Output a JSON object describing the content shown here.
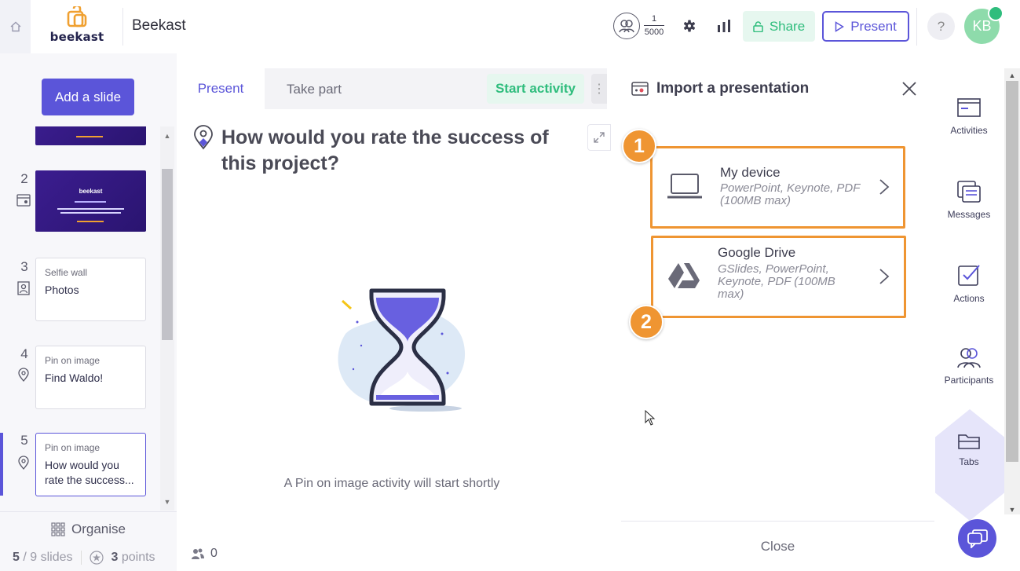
{
  "header": {
    "app_title": "Beekast",
    "logo_text": "beekast",
    "participants_current": "1",
    "participants_max": "5000",
    "share_label": "Share",
    "present_label": "Present",
    "help_label": "?",
    "avatar_initials": "KB"
  },
  "sidebar": {
    "add_slide_label": "Add a slide",
    "slides": [
      {
        "number": "2",
        "thumb_text": "beekast"
      },
      {
        "number": "3",
        "type": "Selfie wall",
        "title": "Photos"
      },
      {
        "number": "4",
        "type": "Pin on image",
        "title": "Find Waldo!"
      },
      {
        "number": "5",
        "type": "Pin on image",
        "title": "How would you rate the success..."
      }
    ],
    "organise_label": "Organise",
    "slide_current": "5",
    "slide_total": "/ 9 slides",
    "points_value": "3",
    "points_label": "points"
  },
  "center": {
    "tab_present": "Present",
    "tab_take_part": "Take part",
    "start_activity": "Start activity",
    "more": "⋮",
    "question": "How would you rate the success of this project?",
    "waiting_text": "A Pin on image activity will start shortly",
    "participants_count": "0"
  },
  "import_panel": {
    "title": "Import a presentation",
    "options": [
      {
        "step": "1",
        "title": "My device",
        "subtitle_line1": "PowerPoint, Keynote, PDF",
        "subtitle_line2": "(100MB max)"
      },
      {
        "step": "2",
        "title": "Google Drive",
        "subtitle_line1": "GSlides, PowerPoint,",
        "subtitle_line2": "Keynote, PDF (100MB",
        "subtitle_line3": "max)"
      }
    ],
    "close_label": "Close"
  },
  "right_rail": {
    "items": [
      "Activities",
      "Messages",
      "Actions",
      "Participants",
      "Tabs"
    ]
  },
  "colors": {
    "accent": "#5b55d9",
    "green": "#2fbd7d",
    "highlight": "#ef9532"
  }
}
